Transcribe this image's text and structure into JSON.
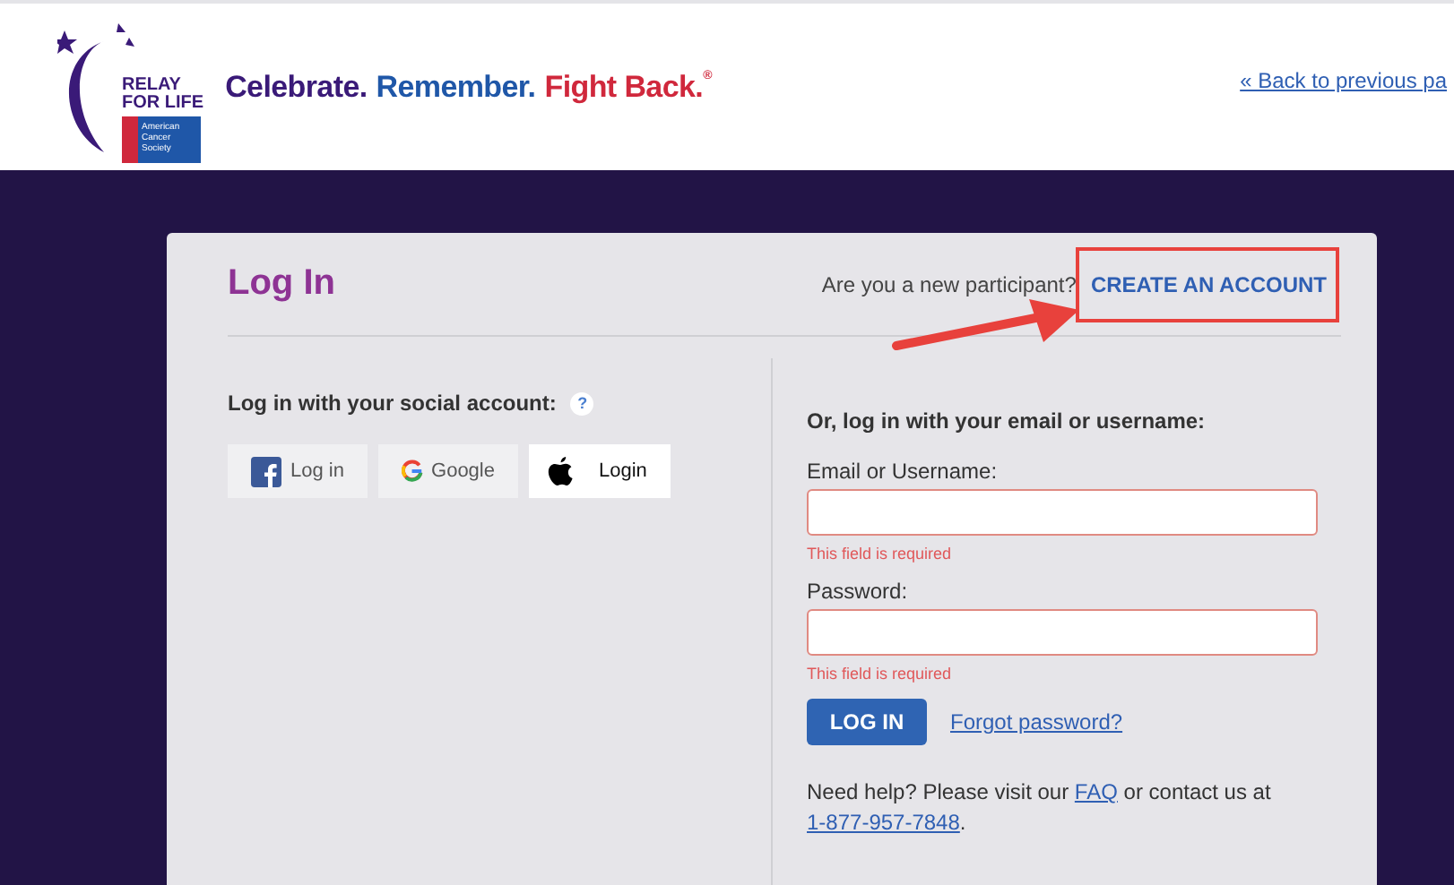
{
  "header": {
    "logo": {
      "line_1": "RELAY",
      "line_2": "FOR LIFE",
      "society": [
        "American",
        "Cancer",
        "Society"
      ]
    },
    "tagline": [
      {
        "text": "Celebrate.",
        "color": "#3a1a78"
      },
      {
        "text": "Remember.",
        "color": "#1f57a8"
      },
      {
        "text": "Fight Back.",
        "color": "#d0283c"
      }
    ],
    "tagline_mark": "®",
    "back_link": "« Back to previous pa"
  },
  "login": {
    "title": "Log In",
    "new_participant": "Are you a new participant?",
    "create_account": "CREATE AN ACCOUNT",
    "social": {
      "heading": "Log in with your social account:",
      "help": "?",
      "buttons": [
        {
          "kind": "facebook",
          "label": "Log in"
        },
        {
          "kind": "google",
          "label": "Google"
        },
        {
          "kind": "apple",
          "label": "Login"
        }
      ]
    },
    "form": {
      "heading": "Or, log in with your email or username:",
      "fields": [
        {
          "label": "Email or Username:",
          "error": "This field is required"
        },
        {
          "label": "Password:",
          "error": "This field is required"
        }
      ],
      "submit": "LOG IN",
      "forgot": "Forgot password?",
      "help": {
        "before": "Need help? Please visit our ",
        "faq": "FAQ",
        "middle": " or contact us at",
        "phone": "1-877-957-7848",
        "after": "."
      }
    }
  }
}
